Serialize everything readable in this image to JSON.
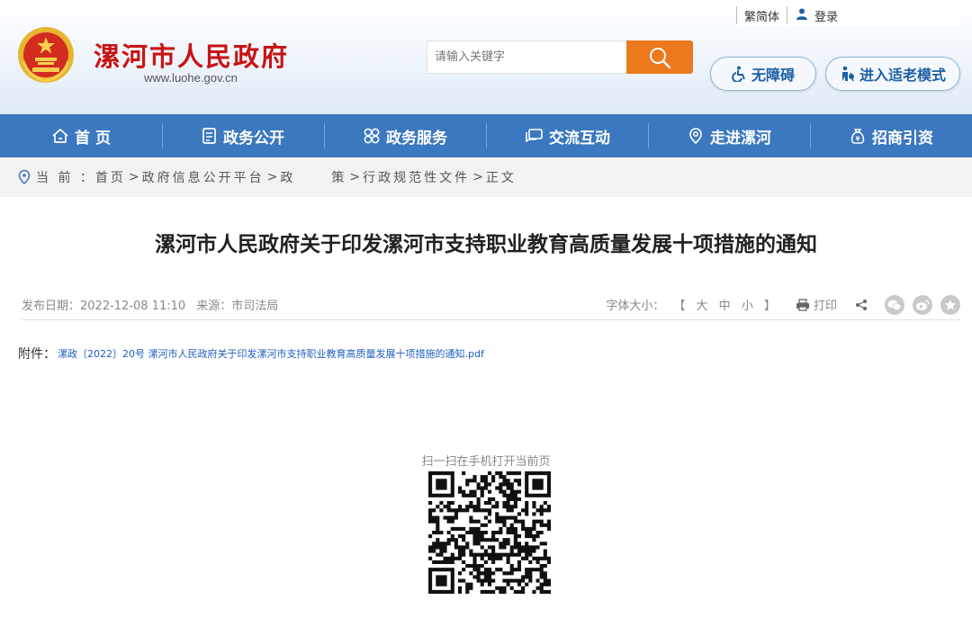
{
  "toplinks": {
    "traditional": "繁简体",
    "login": "登录",
    "user_icon": "user-icon"
  },
  "site": {
    "title": "漯河市人民政府",
    "url": "www.luohe.gov.cn",
    "emblem_icon": "national-emblem"
  },
  "search": {
    "placeholder": "请输入关键字",
    "button_icon": "search-icon"
  },
  "accessibility": {
    "label": "无障碍",
    "icon": "wheelchair-icon"
  },
  "elder_mode": {
    "label": "进入适老模式",
    "icon": "elder-icon"
  },
  "nav": {
    "items": [
      {
        "label": "首 页",
        "icon": "home-icon"
      },
      {
        "label": "政务公开",
        "icon": "document-icon"
      },
      {
        "label": "政务服务",
        "icon": "service-icon"
      },
      {
        "label": "交流互动",
        "icon": "chat-icon"
      },
      {
        "label": "走进漯河",
        "icon": "location-icon"
      },
      {
        "label": "招商引资",
        "icon": "money-bag-icon"
      }
    ]
  },
  "breadcrumb": {
    "prefix": "当 前 ：",
    "items": [
      "首页",
      "政府信息公开平台",
      "政",
      "策",
      "行政规范性文件",
      "正文"
    ],
    "separator": ">"
  },
  "article": {
    "title": "漯河市人民政府关于印发漯河市支持职业教育高质量发展十项措施的通知",
    "publish_date": "发布日期：2022-12-08 11:10",
    "source": "来源：市司法局",
    "font_size_label": "字体大小：",
    "font_sizes": [
      "【",
      "大",
      "中",
      "小",
      "】"
    ],
    "print_label": "打印"
  },
  "attachment": {
    "label": "附件：",
    "file": "漯政〔2022〕20号 漯河市人民政府关于印发漯河市支持职业教育高质量发展十项措施的通知.pdf"
  },
  "qr": {
    "caption": "扫一扫在手机打开当前页"
  },
  "colors": {
    "brand_red": "#c81414",
    "nav_blue": "#3b78c0",
    "search_orange": "#ec7a1d"
  }
}
